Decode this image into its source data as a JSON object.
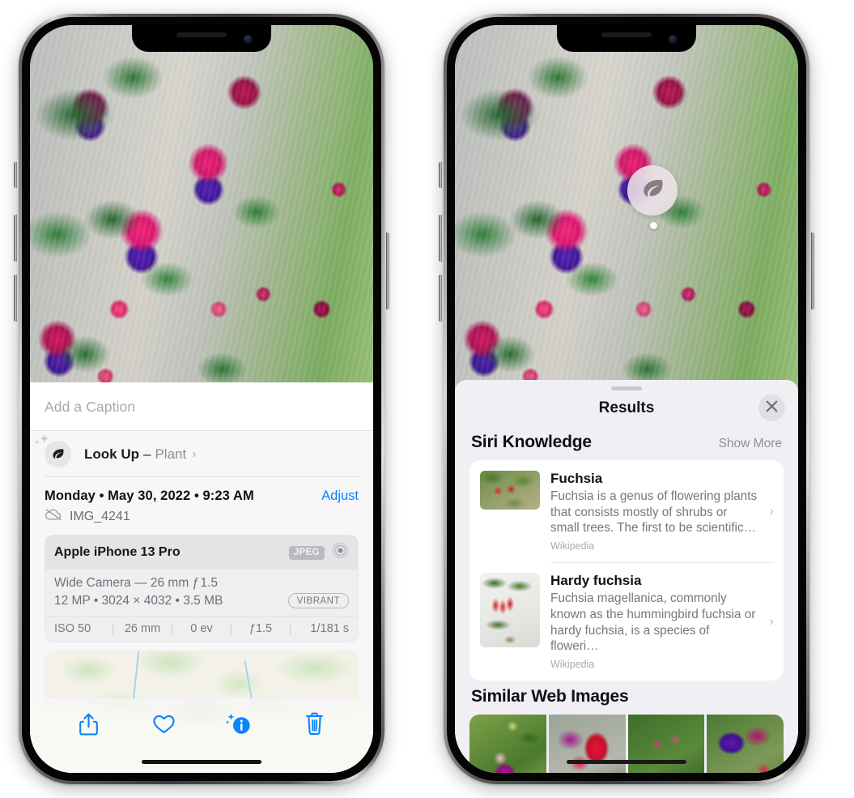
{
  "left_phone": {
    "caption": {
      "placeholder": "Add a Caption",
      "value": ""
    },
    "lookup": {
      "icon": "leaf-icon",
      "label": "Look Up",
      "dash": "–",
      "kind": "Plant",
      "chevron": "›"
    },
    "meta": {
      "date": "Monday • May 30, 2022 • 9:23 AM",
      "adjust_label": "Adjust",
      "filename": "IMG_4241",
      "cloud_icon": "cloud-slash-icon"
    },
    "camera_card": {
      "model": "Apple iPhone 13 Pro",
      "format_badge": "JPEG",
      "lens_icon": "aperture-icon",
      "lens_line": "Wide Camera — 26 mm ƒ 1.5",
      "specs_line": "12 MP • 3024 × 4032 • 3.5 MB",
      "style_badge": "VIBRANT",
      "exif": [
        "ISO 50",
        "26 mm",
        "0 ev",
        "ƒ1.5",
        "1/181 s"
      ]
    },
    "toolbar": [
      {
        "name": "share-button",
        "icon": "share-icon"
      },
      {
        "name": "favorite-button",
        "icon": "heart-icon"
      },
      {
        "name": "info-button",
        "icon": "info-sparkle-icon"
      },
      {
        "name": "delete-button",
        "icon": "trash-icon"
      }
    ],
    "accent_color": "#0a84ff"
  },
  "right_phone": {
    "visual_lookup_badge": {
      "icon": "leaf-icon"
    },
    "sheet": {
      "title": "Results",
      "close_icon": "close-icon",
      "sections": [
        {
          "title": "Siri Knowledge",
          "action": "Show More",
          "items": [
            {
              "title": "Fuchsia",
              "description": "Fuchsia is a genus of flowering plants that consists mostly of shrubs or small trees. The first to be scientific…",
              "source": "Wikipedia",
              "chevron": "›"
            },
            {
              "title": "Hardy fuchsia",
              "description": "Fuchsia magellanica, commonly known as the hummingbird fuchsia or hardy fuchsia, is a species of floweri…",
              "source": "Wikipedia",
              "chevron": "›"
            }
          ]
        },
        {
          "title": "Similar Web Images",
          "action": "",
          "thumbnails": [
            "web-image-1",
            "web-image-2",
            "web-image-3",
            "web-image-4"
          ]
        }
      ]
    }
  }
}
